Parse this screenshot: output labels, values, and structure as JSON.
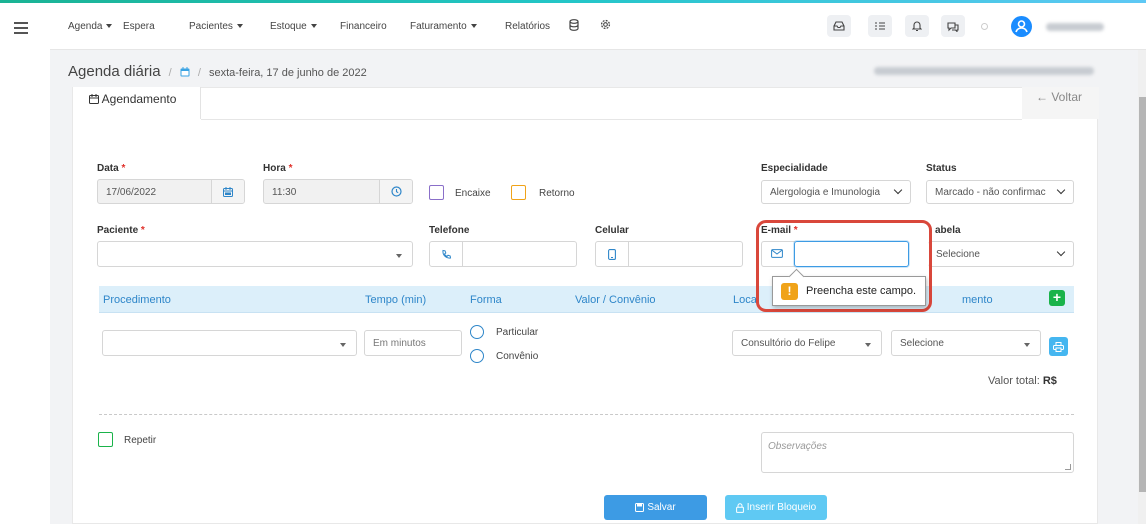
{
  "nav": {
    "items": [
      {
        "label": "Agenda",
        "dropdown": true
      },
      {
        "label": "Espera",
        "dropdown": false
      },
      {
        "label": "Pacientes",
        "dropdown": true
      },
      {
        "label": "Estoque",
        "dropdown": true
      },
      {
        "label": "Financeiro",
        "dropdown": false
      },
      {
        "label": "Faturamento",
        "dropdown": true
      },
      {
        "label": "Relatórios",
        "dropdown": false
      }
    ],
    "icons": [
      "database-icon",
      "gear-icon",
      "inbox-icon",
      "checklist-icon",
      "bell-icon",
      "chat-icon",
      "user-icon"
    ]
  },
  "breadcrumb": {
    "title": "Agenda diária",
    "separator": "/",
    "date": "sexta-feira, 17 de junho de 2022"
  },
  "tab": {
    "label": "Agendamento",
    "back_label": "← Voltar"
  },
  "form": {
    "data": {
      "label": "Data",
      "value": "17/06/2022"
    },
    "hora": {
      "label": "Hora",
      "value": "11:30"
    },
    "required_mark": "*",
    "encaixe": {
      "label": "Encaixe",
      "color": "#8a6fc9"
    },
    "retorno": {
      "label": "Retorno",
      "color": "#f0a319"
    },
    "especialidade": {
      "label": "Especialidade",
      "value": "Alergologia e Imunologia"
    },
    "status": {
      "label": "Status",
      "value": "Marcado - não confirmac"
    },
    "paciente": {
      "label": "Paciente",
      "value": ""
    },
    "telefone": {
      "label": "Telefone",
      "value": ""
    },
    "celular": {
      "label": "Celular",
      "value": ""
    },
    "email": {
      "label": "E-mail",
      "value": ""
    },
    "tabela": {
      "label": "abela",
      "value": "Selecione"
    }
  },
  "procedimentos": {
    "headers": {
      "procedimento": "Procedimento",
      "tempo": "Tempo (min)",
      "forma": "Forma",
      "valor": "Valor / Convênio",
      "local": "Loca",
      "atendimento": "mento"
    },
    "row": {
      "procedimento": "",
      "tempo_placeholder": "Em minutos",
      "forma_options": [
        "Particular",
        "Convênio"
      ],
      "local": "Consultório do Felipe",
      "atendimento": "Selecione"
    },
    "total_label": "Valor total:",
    "total_value": "R$"
  },
  "repetir_label": "Repetir",
  "observacoes_placeholder": "Observações",
  "buttons": {
    "salvar": "Salvar",
    "bloqueio": "Inserir Bloqueio"
  },
  "tooltip": {
    "text": "Preencha este campo.",
    "icon": "!"
  },
  "colors": {
    "accent": "#2e86c9",
    "header_bg": "#dceffa",
    "save": "#3d9be4",
    "block": "#5fc9f3",
    "alert": "#d9473b",
    "add": "#1ab34a",
    "checkbox_green": "#1ab34a"
  }
}
